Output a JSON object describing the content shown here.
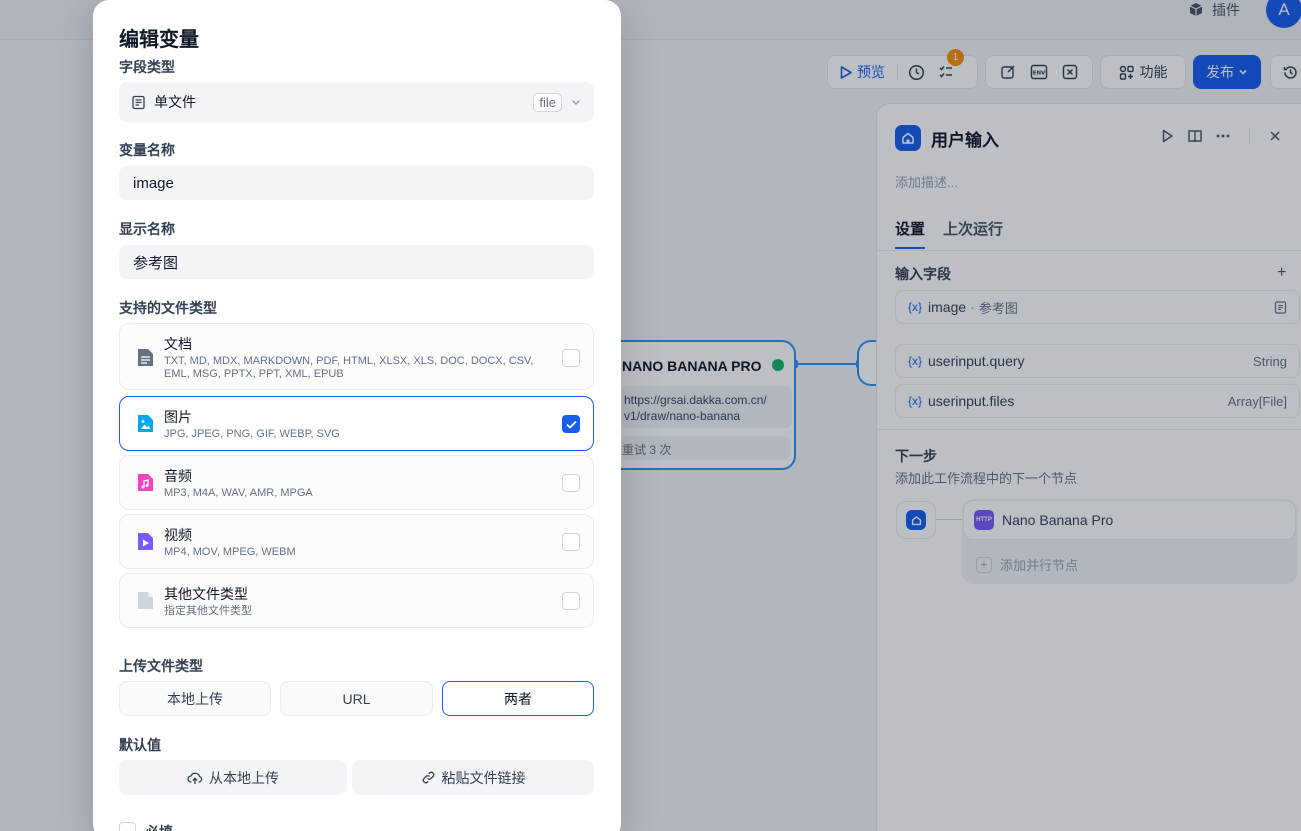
{
  "topbar": {
    "plugin_label": "插件",
    "avatar_initial": "A"
  },
  "toolbar": {
    "preview_label": "预览",
    "checklist_badge": "1",
    "feature_label": "功能",
    "publish_label": "发布",
    "env_label": "ENV"
  },
  "workflow_node": {
    "title": "NANO BANANA PRO",
    "url_line1": "https://grsai.dakka.com.cn/",
    "url_line2": "v1/draw/nano-banana",
    "retry": "重试 3 次"
  },
  "right_panel": {
    "title": "用户输入",
    "description_placeholder": "添加描述...",
    "tabs": [
      "设置",
      "上次运行"
    ],
    "input_fields_label": "输入字段",
    "variables": [
      {
        "name": "image",
        "label": "参考图",
        "type": ""
      },
      {
        "name": "userinput.query",
        "label": "",
        "type": "String"
      },
      {
        "name": "userinput.files",
        "label": "",
        "type": "Array[File]"
      }
    ],
    "next_step_label": "下一步",
    "next_step_desc": "添加此工作流程中的下一个节点",
    "next_node_name": "Nano Banana Pro",
    "next_node_tag": "HTTP",
    "add_parallel": "添加并行节点"
  },
  "modal": {
    "title": "编辑变量",
    "field_type_label": "字段类型",
    "field_type_value": "单文件",
    "field_type_tag": "file",
    "var_name_label": "变量名称",
    "var_name_value": "image",
    "display_name_label": "显示名称",
    "display_name_value": "参考图",
    "file_types_label": "支持的文件类型",
    "file_types": [
      {
        "name": "文档",
        "exts": "TXT, MD, MDX, MARKDOWN, PDF, HTML, XLSX, XLS, DOC, DOCX, CSV, EML, MSG, PPTX, PPT, XML, EPUB",
        "checked": false,
        "color": "#667085"
      },
      {
        "name": "图片",
        "exts": "JPG, JPEG, PNG, GIF, WEBP, SVG",
        "checked": true,
        "color": "#0ba5ec"
      },
      {
        "name": "音频",
        "exts": "MP3, M4A, WAV, AMR, MPGA",
        "checked": false,
        "color": "#ee46bc"
      },
      {
        "name": "视频",
        "exts": "MP4, MOV, MPEG, WEBM",
        "checked": false,
        "color": "#7a5af8"
      },
      {
        "name": "其他文件类型",
        "exts": "指定其他文件类型",
        "checked": false,
        "color": "#d0d5dd"
      }
    ],
    "upload_type_label": "上传文件类型",
    "upload_options": [
      "本地上传",
      "URL",
      "两者"
    ],
    "upload_selected": "两者",
    "default_label": "默认值",
    "default_upload_local": "从本地上传",
    "default_paste_link": "粘贴文件链接",
    "required_label": "必填"
  }
}
